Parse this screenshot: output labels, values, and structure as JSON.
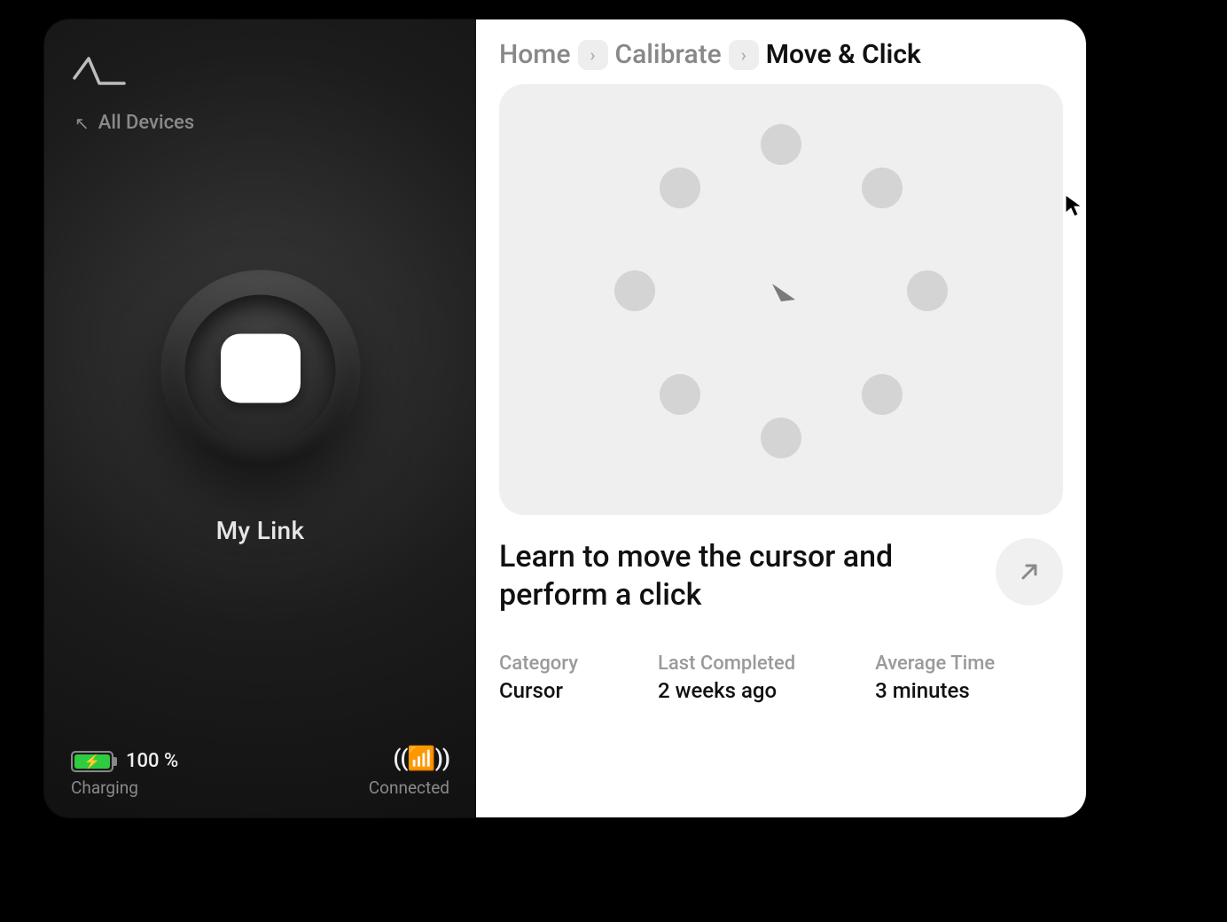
{
  "sidebar": {
    "all_devices_label": "All Devices",
    "device_name": "My Link",
    "battery": {
      "percent_label": "100 %",
      "state_label": "Charging",
      "fill_pct": 100
    },
    "connection": {
      "state_label": "Connected"
    }
  },
  "breadcrumb": {
    "items": [
      "Home",
      "Calibrate",
      "Move & Click"
    ]
  },
  "exercise": {
    "description": "Learn to move the cursor and perform a click",
    "meta": {
      "category_label": "Category",
      "category_value": "Cursor",
      "last_completed_label": "Last Completed",
      "last_completed_value": "2 weeks ago",
      "avg_time_label": "Average Time",
      "avg_time_value": "3 minutes"
    }
  }
}
